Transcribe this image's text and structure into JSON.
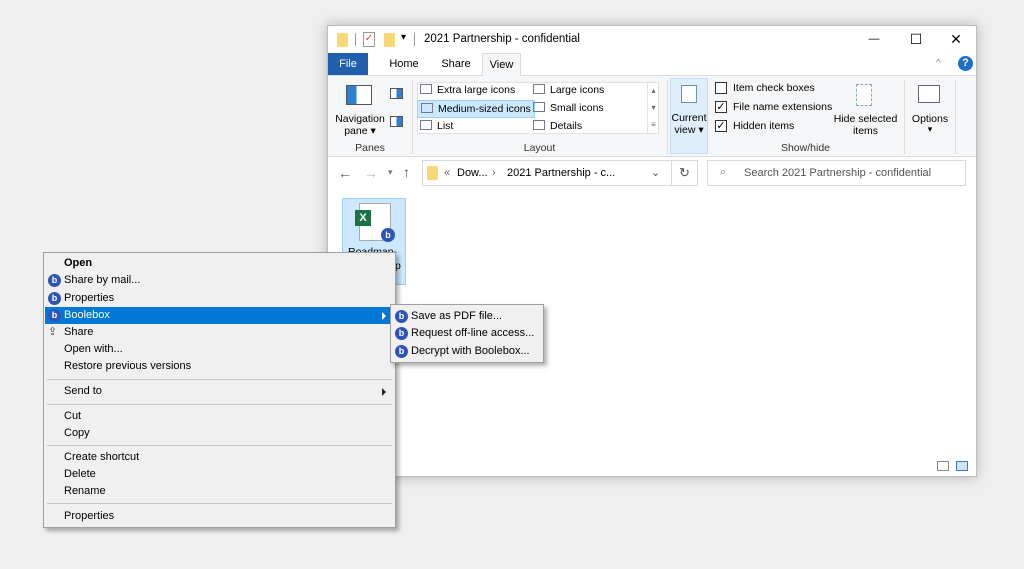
{
  "window": {
    "title": "2021 Partnership - confidential",
    "controls": {
      "minimize": "—",
      "maximize": "☐",
      "close": "✕"
    },
    "tabs": [
      {
        "label": "File"
      },
      {
        "label": "Home"
      },
      {
        "label": "Share"
      },
      {
        "label": "View"
      }
    ],
    "help": "?",
    "ribbon": {
      "panes": {
        "navigation_pane": "Navigation",
        "navigation_pane2": "pane ▾",
        "group": "Panes"
      },
      "layout": {
        "items": [
          "Extra large icons",
          "Large icons",
          "Medium-sized icons",
          "Small icons",
          "List",
          "Details"
        ],
        "selected": "Medium-sized icons",
        "group": "Layout"
      },
      "current_view": {
        "line1": "Current",
        "line2": "view ▾"
      },
      "show_hide": {
        "checkboxes": [
          {
            "label": "Item check boxes",
            "checked": false
          },
          {
            "label": "File name extensions",
            "checked": true
          },
          {
            "label": "Hidden items",
            "checked": true
          }
        ],
        "hide_selected": {
          "line1": "Hide selected",
          "line2": "items"
        },
        "group": "Show/hide"
      },
      "options": {
        "label": "Options",
        "arrow": "▾"
      }
    },
    "address": {
      "prefix": "«",
      "crumbs": [
        "Dow...",
        "2021 Partnership - c..."
      ],
      "separator": "›"
    },
    "search": {
      "placeholder": "Search 2021 Partnership - confidential"
    },
    "file": {
      "name": "Roadman-",
      "name_tail": "p"
    }
  },
  "context_menu": {
    "items": [
      {
        "label": "Open",
        "bold": true
      },
      {
        "label": "Share by mail...",
        "icon": "boolebox-mail-icon"
      },
      {
        "label": "Properties",
        "icon": "boolebox-properties-icon"
      },
      {
        "label": "Boolebox",
        "icon": "boolebox-icon",
        "submenu": true,
        "highlighted": true
      },
      {
        "label": "Share",
        "icon": "share-icon"
      },
      {
        "label": "Open with..."
      },
      {
        "label": "Restore previous versions"
      },
      {
        "label": "Send to",
        "submenu": true
      },
      {
        "label": "Cut"
      },
      {
        "label": "Copy"
      },
      {
        "label": "Create shortcut"
      },
      {
        "label": "Delete"
      },
      {
        "label": "Rename"
      },
      {
        "label": "Properties"
      }
    ],
    "submenu": [
      {
        "label": "Save as PDF file...",
        "icon": "boolebox-pdf-icon"
      },
      {
        "label": "Request off-line access...",
        "icon": "boolebox-offline-icon"
      },
      {
        "label": "Decrypt with Boolebox...",
        "icon": "boolebox-decrypt-icon"
      }
    ]
  },
  "colors": {
    "accent": "#0078d7",
    "file_tab": "#1f5fae",
    "boolebox": "#2f55b4",
    "selection": "#cce8ff"
  }
}
